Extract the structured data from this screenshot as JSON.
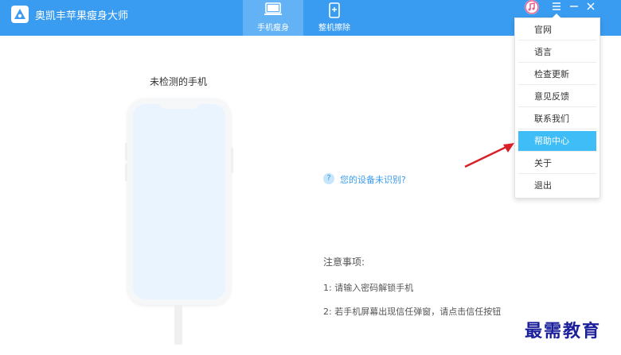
{
  "app": {
    "title": "奥凯丰苹果瘦身大师"
  },
  "tabs": [
    {
      "label": "手机瘦身",
      "active": true,
      "icon": "laptop-icon"
    },
    {
      "label": "整机擦除",
      "active": false,
      "icon": "phone-erase-icon"
    }
  ],
  "window_controls": [
    "itunes-icon",
    "menu-icon",
    "minimize-icon",
    "close-icon"
  ],
  "menu": {
    "items": [
      {
        "label": "官网"
      },
      {
        "label": "语言"
      },
      {
        "label": "检查更新"
      },
      {
        "label": "意见反馈"
      },
      {
        "label": "联系我们"
      },
      {
        "label": "帮助中心",
        "highlighted": true
      },
      {
        "label": "关于"
      },
      {
        "label": "退出"
      }
    ]
  },
  "main": {
    "phone_status": "未检测的手机",
    "help_link": "您的设备未识别?",
    "notes_title": "注意事项:",
    "notes": [
      "1: 请输入密码解锁手机",
      "2: 若手机屏幕出现信任弹窗，请点击信任按钮"
    ]
  },
  "watermark": "最需教育",
  "colors": {
    "header": "#3a9cf0",
    "active_tab": "#62b2f5",
    "menu_highlight": "#3fbdf6",
    "link": "#3a9cf0",
    "arrow": "#d9202a"
  }
}
